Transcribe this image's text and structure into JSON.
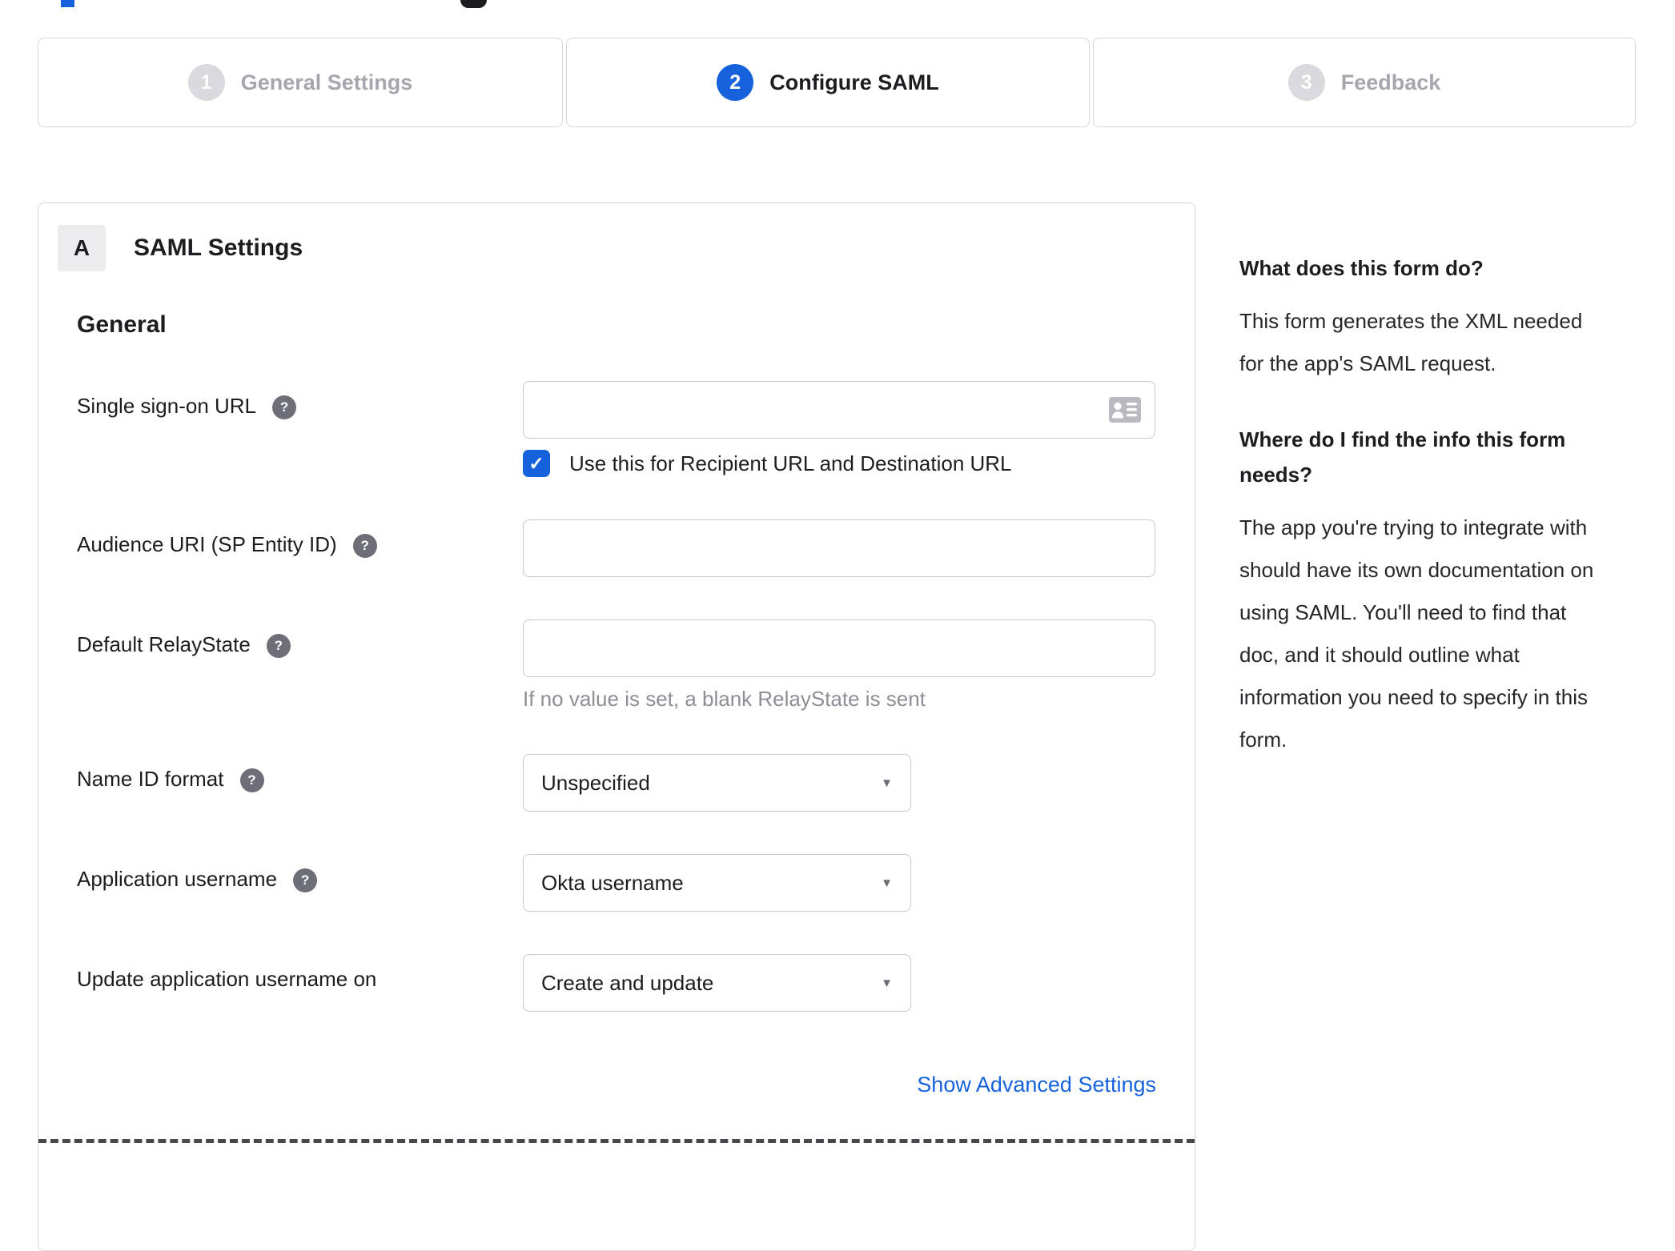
{
  "colors": {
    "accent_blue": "#1662dd",
    "border_gray": "#d5d5da",
    "text_dark": "#1d1d21",
    "hint_gray": "#8e8e96",
    "step_inactive_gray": "#a6a6ae"
  },
  "icons": {
    "help_icon": "?",
    "dropdown_icon": "▼",
    "check_icon": "✓"
  },
  "stepper": {
    "steps": [
      {
        "number": "1",
        "label": "General Settings",
        "state": "inactive"
      },
      {
        "number": "2",
        "label": "Configure SAML",
        "state": "active"
      },
      {
        "number": "3",
        "label": "Feedback",
        "state": "inactive"
      }
    ]
  },
  "panel": {
    "badge": "A",
    "title": "SAML Settings",
    "section_title": "General",
    "sso": {
      "label": "Single sign-on URL",
      "value": "",
      "checkbox_label": "Use this for Recipient URL and Destination URL",
      "checked": true
    },
    "audience": {
      "label": "Audience URI (SP Entity ID)",
      "value": ""
    },
    "relay": {
      "label": "Default RelayState",
      "value": "",
      "hint": "If no value is set, a blank RelayState is sent"
    },
    "name_id": {
      "label": "Name ID format",
      "value": "Unspecified"
    },
    "app_username": {
      "label": "Application username",
      "value": "Okta username"
    },
    "update_username": {
      "label": "Update application username on",
      "value": "Create and update"
    },
    "advanced_link": "Show Advanced Settings"
  },
  "sidebar": {
    "q1": "What does this form do?",
    "a1_lines": [
      "This form generates the XML needed",
      "for the app's SAML request."
    ],
    "q2_lines": [
      "Where do I find the info this form",
      "needs?"
    ],
    "a2_lines": [
      "The app you're trying to integrate with",
      "should have its own documentation on",
      "using SAML. You'll need to find that",
      "doc, and it should outline what",
      "information you need to specify in this",
      "form."
    ]
  }
}
